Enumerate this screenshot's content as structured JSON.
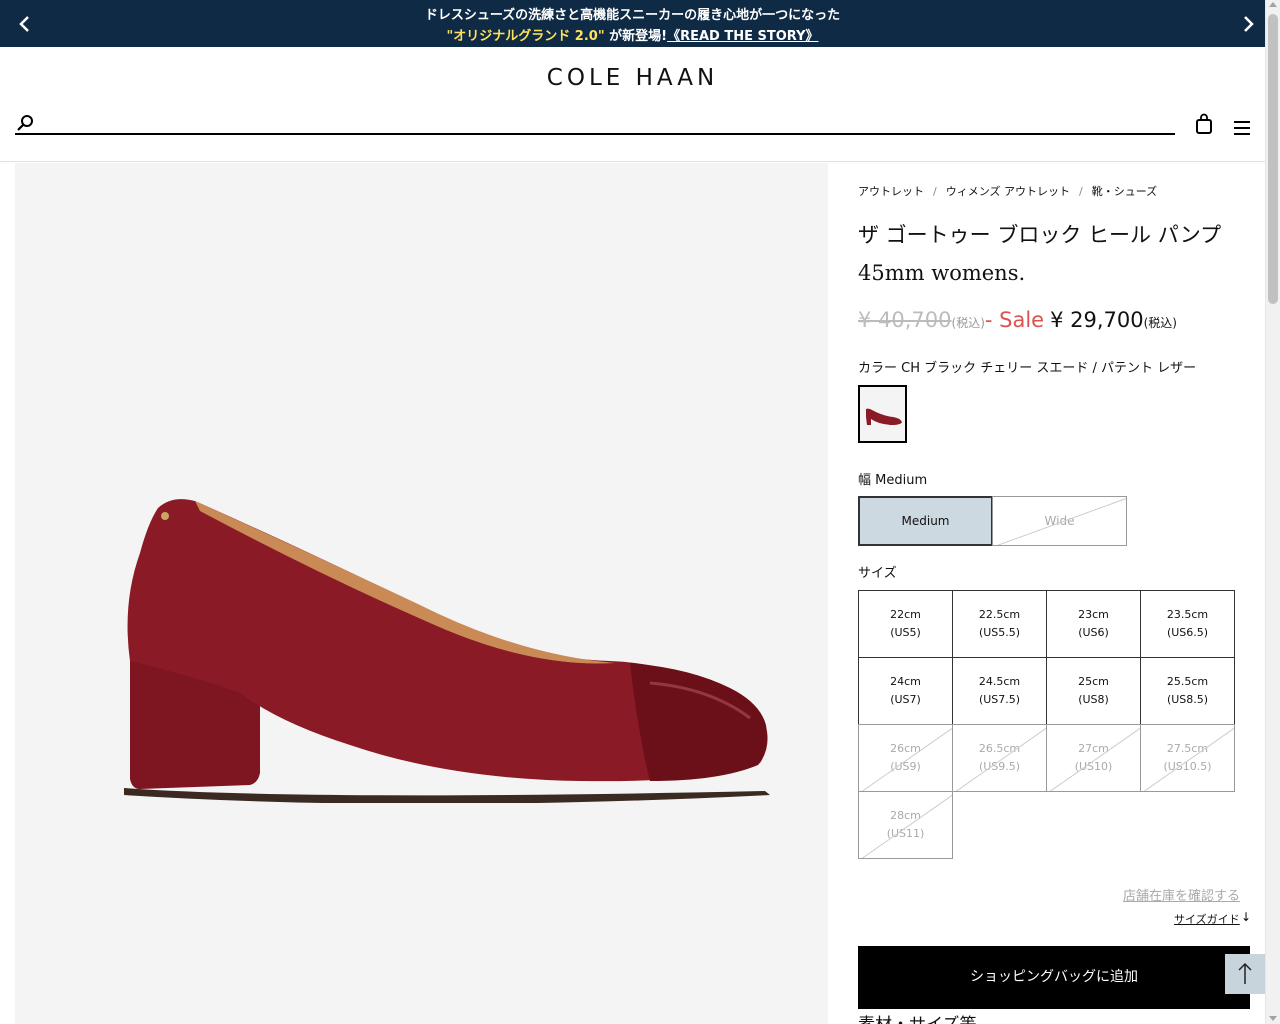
{
  "promo": {
    "line1": "ドレスシューズの洗練さと高機能スニーカーの履き心地が一つになった",
    "highlight": "\"オリジナルグランド 2.0\"",
    "announce": " が新登場!",
    "story_link": "《READ THE STORY》",
    "prev_icon": "chevron-left-icon",
    "next_icon": "chevron-right-icon"
  },
  "header": {
    "logo": "COLE HAAN",
    "search_placeholder": "",
    "search_icon": "search-icon",
    "bag_icon": "shopping-bag-icon",
    "menu_icon": "menu-icon"
  },
  "breadcrumb": [
    "アウトレット",
    "ウィメンズ アウトレット",
    "靴・シューズ"
  ],
  "product": {
    "title_line1": "ザ ゴートゥー ブロック ヒール パンプ",
    "title_line2": "45mm womens.",
    "original_price": "¥ 40,700",
    "tax_note": "(税込)",
    "sale_label": "- Sale",
    "sale_price": "¥ 29,700",
    "tax_note2": "(税込)",
    "color_label": "カラー CH ブラック チェリー スエード / パテント レザー",
    "swatch_color": "#8a1a25"
  },
  "width": {
    "label": "幅 Medium",
    "options": [
      {
        "label": "Medium",
        "selected": true,
        "available": true
      },
      {
        "label": "Wide",
        "selected": false,
        "available": false
      }
    ]
  },
  "size": {
    "label": "サイズ",
    "options": [
      {
        "cm": "22cm",
        "us": "(US5)",
        "available": true
      },
      {
        "cm": "22.5cm",
        "us": "(US5.5)",
        "available": true
      },
      {
        "cm": "23cm",
        "us": "(US6)",
        "available": true
      },
      {
        "cm": "23.5cm",
        "us": "(US6.5)",
        "available": true
      },
      {
        "cm": "24cm",
        "us": "(US7)",
        "available": true
      },
      {
        "cm": "24.5cm",
        "us": "(US7.5)",
        "available": true
      },
      {
        "cm": "25cm",
        "us": "(US8)",
        "available": true
      },
      {
        "cm": "25.5cm",
        "us": "(US8.5)",
        "available": true
      },
      {
        "cm": "26cm",
        "us": "(US9)",
        "available": false
      },
      {
        "cm": "26.5cm",
        "us": "(US9.5)",
        "available": false
      },
      {
        "cm": "27cm",
        "us": "(US10)",
        "available": false
      },
      {
        "cm": "27.5cm",
        "us": "(US10.5)",
        "available": false
      },
      {
        "cm": "28cm",
        "us": "(US11)",
        "available": false
      }
    ]
  },
  "links": {
    "store_stock": "店舗在庫を確認する",
    "size_guide": "サイズガイド",
    "size_guide_arrow": "↓"
  },
  "add_to_bag": "ショッピングバッグに追加",
  "details_heading": "素材・サイズ等",
  "to_top_icon": "arrow-up-icon",
  "colors": {
    "promo_bg": "#0f2a45",
    "promo_highlight": "#ffe25a",
    "sale_red": "#d9534f",
    "selected_width_bg": "#cdd9e0",
    "shoe_suede": "#8a1a25"
  }
}
